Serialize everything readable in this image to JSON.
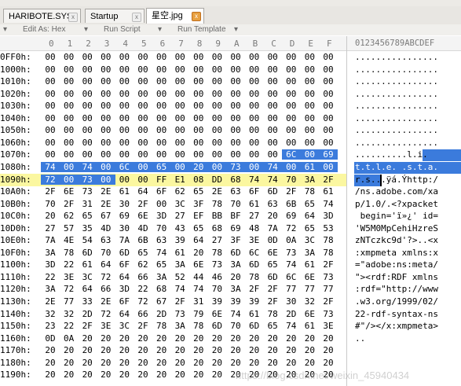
{
  "tabs": [
    {
      "label": "HARIBOTE.SYS",
      "active": false
    },
    {
      "label": "Startup",
      "active": false
    },
    {
      "label": "星空.jpg",
      "active": true
    }
  ],
  "template_bar": {
    "edit_as": "Edit As: Hex",
    "run_script": "Run Script",
    "run_template": "Run Template"
  },
  "column_header": [
    "0",
    "1",
    "2",
    "3",
    "4",
    "5",
    "6",
    "7",
    "8",
    "9",
    "A",
    "B",
    "C",
    "D",
    "E",
    "F"
  ],
  "ascii_header": "0123456789ABCDEF",
  "rows": [
    {
      "addr": "0FF0h:",
      "bytes": [
        "00",
        "00",
        "00",
        "00",
        "00",
        "00",
        "00",
        "00",
        "00",
        "00",
        "00",
        "00",
        "00",
        "00",
        "00",
        "00"
      ],
      "ascii": "................"
    },
    {
      "addr": "1000h:",
      "bytes": [
        "00",
        "00",
        "00",
        "00",
        "00",
        "00",
        "00",
        "00",
        "00",
        "00",
        "00",
        "00",
        "00",
        "00",
        "00",
        "00"
      ],
      "ascii": "................"
    },
    {
      "addr": "1010h:",
      "bytes": [
        "00",
        "00",
        "00",
        "00",
        "00",
        "00",
        "00",
        "00",
        "00",
        "00",
        "00",
        "00",
        "00",
        "00",
        "00",
        "00"
      ],
      "ascii": "................"
    },
    {
      "addr": "1020h:",
      "bytes": [
        "00",
        "00",
        "00",
        "00",
        "00",
        "00",
        "00",
        "00",
        "00",
        "00",
        "00",
        "00",
        "00",
        "00",
        "00",
        "00"
      ],
      "ascii": "................"
    },
    {
      "addr": "1030h:",
      "bytes": [
        "00",
        "00",
        "00",
        "00",
        "00",
        "00",
        "00",
        "00",
        "00",
        "00",
        "00",
        "00",
        "00",
        "00",
        "00",
        "00"
      ],
      "ascii": "................"
    },
    {
      "addr": "1040h:",
      "bytes": [
        "00",
        "00",
        "00",
        "00",
        "00",
        "00",
        "00",
        "00",
        "00",
        "00",
        "00",
        "00",
        "00",
        "00",
        "00",
        "00"
      ],
      "ascii": "................"
    },
    {
      "addr": "1050h:",
      "bytes": [
        "00",
        "00",
        "00",
        "00",
        "00",
        "00",
        "00",
        "00",
        "00",
        "00",
        "00",
        "00",
        "00",
        "00",
        "00",
        "00"
      ],
      "ascii": "................"
    },
    {
      "addr": "1060h:",
      "bytes": [
        "00",
        "00",
        "00",
        "00",
        "00",
        "00",
        "00",
        "00",
        "00",
        "00",
        "00",
        "00",
        "00",
        "00",
        "00",
        "00"
      ],
      "ascii": "................"
    },
    {
      "addr": "1070h:",
      "bytes": [
        "00",
        "00",
        "00",
        "00",
        "00",
        "00",
        "00",
        "00",
        "00",
        "00",
        "00",
        "00",
        "00",
        "6C",
        "00",
        "69",
        "00"
      ],
      "ascii": "..........l.i."
    },
    {
      "addr": "1080h:",
      "bytes": [
        "74",
        "00",
        "74",
        "00",
        "6C",
        "00",
        "65",
        "00",
        "20",
        "00",
        "73",
        "00",
        "74",
        "00",
        "61",
        "00"
      ],
      "ascii": "t.t.l.e. .s.t.a."
    },
    {
      "addr": "1090h:",
      "bytes": [
        "72",
        "00",
        "73",
        "00",
        "00",
        "00",
        "FF",
        "E1",
        "08",
        "DD",
        "68",
        "74",
        "74",
        "70",
        "3A",
        "2F"
      ],
      "ascii": "r.s...ÿá.Ýhttp:/"
    },
    {
      "addr": "10A0h:",
      "bytes": [
        "2F",
        "6E",
        "73",
        "2E",
        "61",
        "64",
        "6F",
        "62",
        "65",
        "2E",
        "63",
        "6F",
        "6D",
        "2F",
        "78",
        "61"
      ],
      "ascii": "/ns.adobe.com/xa"
    },
    {
      "addr": "10B0h:",
      "bytes": [
        "70",
        "2F",
        "31",
        "2E",
        "30",
        "2F",
        "00",
        "3C",
        "3F",
        "78",
        "70",
        "61",
        "63",
        "6B",
        "65",
        "74"
      ],
      "ascii": "p/1.0/.<?xpacket"
    },
    {
      "addr": "10C0h:",
      "bytes": [
        "20",
        "62",
        "65",
        "67",
        "69",
        "6E",
        "3D",
        "27",
        "EF",
        "BB",
        "BF",
        "27",
        "20",
        "69",
        "64",
        "3D"
      ],
      "ascii": " begin='ï»¿' id="
    },
    {
      "addr": "10D0h:",
      "bytes": [
        "27",
        "57",
        "35",
        "4D",
        "30",
        "4D",
        "70",
        "43",
        "65",
        "68",
        "69",
        "48",
        "7A",
        "72",
        "65",
        "53"
      ],
      "ascii": "'W5M0MpCehiHzreS"
    },
    {
      "addr": "10E0h:",
      "bytes": [
        "7A",
        "4E",
        "54",
        "63",
        "7A",
        "6B",
        "63",
        "39",
        "64",
        "27",
        "3F",
        "3E",
        "0D",
        "0A",
        "3C",
        "78"
      ],
      "ascii": "zNTczkc9d'?>..<x"
    },
    {
      "addr": "10F0h:",
      "bytes": [
        "3A",
        "78",
        "6D",
        "70",
        "6D",
        "65",
        "74",
        "61",
        "20",
        "78",
        "6D",
        "6C",
        "6E",
        "73",
        "3A",
        "78"
      ],
      "ascii": ":xmpmeta xmlns:x"
    },
    {
      "addr": "1100h:",
      "bytes": [
        "3D",
        "22",
        "61",
        "64",
        "6F",
        "62",
        "65",
        "3A",
        "6E",
        "73",
        "3A",
        "6D",
        "65",
        "74",
        "61",
        "2F"
      ],
      "ascii": "=\"adobe:ns:meta/"
    },
    {
      "addr": "1110h:",
      "bytes": [
        "22",
        "3E",
        "3C",
        "72",
        "64",
        "66",
        "3A",
        "52",
        "44",
        "46",
        "20",
        "78",
        "6D",
        "6C",
        "6E",
        "73"
      ],
      "ascii": "\"><rdf:RDF xmlns"
    },
    {
      "addr": "1120h:",
      "bytes": [
        "3A",
        "72",
        "64",
        "66",
        "3D",
        "22",
        "68",
        "74",
        "74",
        "70",
        "3A",
        "2F",
        "2F",
        "77",
        "77",
        "77"
      ],
      "ascii": ":rdf=\"http://www"
    },
    {
      "addr": "1130h:",
      "bytes": [
        "2E",
        "77",
        "33",
        "2E",
        "6F",
        "72",
        "67",
        "2F",
        "31",
        "39",
        "39",
        "39",
        "2F",
        "30",
        "32",
        "2F"
      ],
      "ascii": ".w3.org/1999/02/"
    },
    {
      "addr": "1140h:",
      "bytes": [
        "32",
        "32",
        "2D",
        "72",
        "64",
        "66",
        "2D",
        "73",
        "79",
        "6E",
        "74",
        "61",
        "78",
        "2D",
        "6E",
        "73"
      ],
      "ascii": "22-rdf-syntax-ns"
    },
    {
      "addr": "1150h:",
      "bytes": [
        "23",
        "22",
        "2F",
        "3E",
        "3C",
        "2F",
        "78",
        "3A",
        "78",
        "6D",
        "70",
        "6D",
        "65",
        "74",
        "61",
        "3E"
      ],
      "ascii": "#\"/></x:xmpmeta>"
    },
    {
      "addr": "1160h:",
      "bytes": [
        "0D",
        "0A",
        "20",
        "20",
        "20",
        "20",
        "20",
        "20",
        "20",
        "20",
        "20",
        "20",
        "20",
        "20",
        "20",
        "20"
      ],
      "ascii": "..              "
    },
    {
      "addr": "1170h:",
      "bytes": [
        "20",
        "20",
        "20",
        "20",
        "20",
        "20",
        "20",
        "20",
        "20",
        "20",
        "20",
        "20",
        "20",
        "20",
        "20",
        "20"
      ],
      "ascii": "                "
    },
    {
      "addr": "1180h:",
      "bytes": [
        "20",
        "20",
        "20",
        "20",
        "20",
        "20",
        "20",
        "20",
        "20",
        "20",
        "20",
        "20",
        "20",
        "20",
        "20",
        "20"
      ],
      "ascii": "                "
    },
    {
      "addr": "1190h:",
      "bytes": [
        "20",
        "20",
        "20",
        "20",
        "20",
        "20",
        "20",
        "20",
        "20",
        "20",
        "20",
        "20",
        "20",
        "20",
        "20",
        "20"
      ],
      "ascii": "                "
    }
  ],
  "watermark": "https://blog.csdn.net/weixin_45940434",
  "colors": {
    "selection": "#3b7bdc",
    "current_row": "#fbf7a0",
    "address": "#000000"
  }
}
